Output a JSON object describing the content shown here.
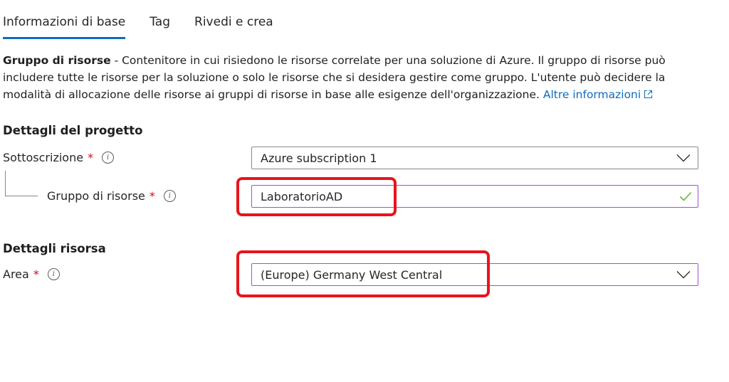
{
  "tabs": [
    {
      "label": "Informazioni di base",
      "active": true
    },
    {
      "label": "Tag",
      "active": false
    },
    {
      "label": "Rivedi e crea",
      "active": false
    }
  ],
  "description": {
    "bold": "Gruppo di risorse",
    "text": " - Contenitore in cui risiedono le risorse correlate per una soluzione di Azure. Il gruppo di risorse può includere tutte le risorse per la soluzione o solo le risorse che si desidera gestire come gruppo. L'utente può decidere la modalità di allocazione delle risorse ai gruppi di risorse in base alle esigenze dell'organizzazione. ",
    "link": "Altre informazioni"
  },
  "project_details": {
    "title": "Dettagli del progetto",
    "subscription": {
      "label": "Sottoscrizione",
      "required": "*",
      "value": "Azure subscription 1"
    },
    "resource_group": {
      "label": "Gruppo di risorse",
      "required": "*",
      "value": "LaboratorioAD"
    }
  },
  "resource_details": {
    "title": "Dettagli risorsa",
    "region": {
      "label": "Area",
      "required": "*",
      "value": "(Europe) Germany West Central"
    }
  },
  "icons": {
    "info": "info-icon",
    "chevron": "chevron-down-icon",
    "check": "checkmark-icon",
    "external": "external-link-icon"
  },
  "colors": {
    "tab_underline": "#0f6cbd",
    "link": "#0f6cbd",
    "required": "#c50f1f",
    "valid_border": "#a34fd4",
    "valid_check": "#5fb83a",
    "annotation": "#e8131d"
  },
  "info_glyph": "i"
}
